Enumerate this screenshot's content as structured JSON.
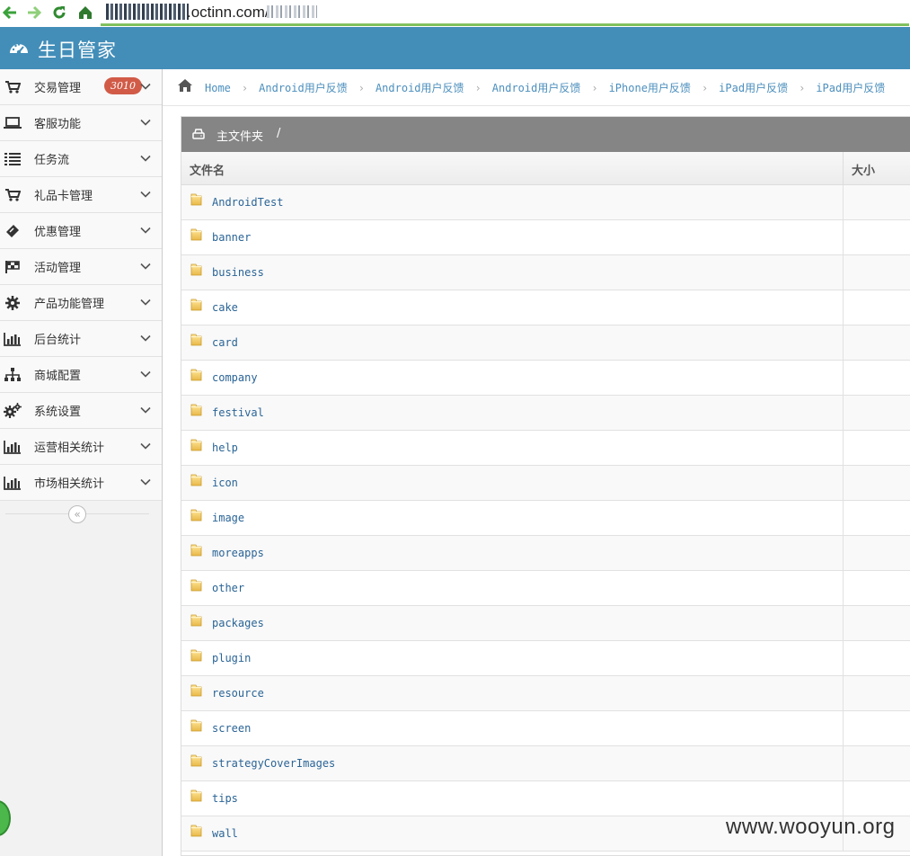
{
  "browser": {
    "url_visible": ".octinn.com/"
  },
  "app": {
    "title": "生日管家"
  },
  "sidebar": {
    "items": [
      {
        "label": "交易管理",
        "icon": "cart-icon",
        "badge": "3010"
      },
      {
        "label": "客服功能",
        "icon": "laptop-icon"
      },
      {
        "label": "任务流",
        "icon": "list-icon"
      },
      {
        "label": "礼品卡管理",
        "icon": "cart-icon"
      },
      {
        "label": "优惠管理",
        "icon": "ticket-icon"
      },
      {
        "label": "活动管理",
        "icon": "flag-icon"
      },
      {
        "label": "产品功能管理",
        "icon": "gear-icon"
      },
      {
        "label": "后台统计",
        "icon": "bar-chart-icon"
      },
      {
        "label": "商城配置",
        "icon": "sitemap-icon"
      },
      {
        "label": "系统设置",
        "icon": "gears-icon"
      },
      {
        "label": "运营相关统计",
        "icon": "bar-chart-icon"
      },
      {
        "label": "市场相关统计",
        "icon": "bar-chart-icon"
      }
    ],
    "collapse_label": "«"
  },
  "breadcrumb": {
    "items": [
      "Home",
      "Android用户反馈",
      "Android用户反馈",
      "Android用户反馈",
      "iPhone用户反馈",
      "iPad用户反馈",
      "iPad用户反馈"
    ]
  },
  "panel": {
    "title": "主文件夹",
    "path": "/"
  },
  "table": {
    "columns": [
      "文件名",
      "大小"
    ],
    "rows": [
      "AndroidTest",
      "banner",
      "business",
      "cake",
      "card",
      "company",
      "festival",
      "help",
      "icon",
      "image",
      "moreapps",
      "other",
      "packages",
      "plugin",
      "resource",
      "screen",
      "strategyCoverImages",
      "tips",
      "wall"
    ]
  },
  "watermark": "www.wooyun.org",
  "colors": {
    "header_blue": "#438eb9",
    "badge_red": "#d15b47",
    "link_blue": "#2a6496",
    "panel_gray": "#858585"
  }
}
